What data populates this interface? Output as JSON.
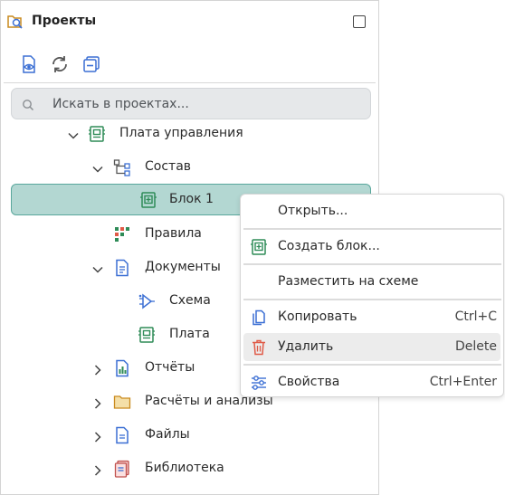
{
  "header": {
    "title": "Проекты",
    "icon": "project-search-icon"
  },
  "toolbar": {
    "buttons": [
      "document-view-icon",
      "refresh-icon",
      "collapse-all-icon"
    ]
  },
  "search": {
    "placeholder": "Искать в проектах..."
  },
  "tree": [
    {
      "label": "Плата управления",
      "icon": "pcb-board-icon",
      "expanded": true
    },
    {
      "label": "Состав",
      "icon": "hierarchy-icon",
      "expanded": true
    },
    {
      "label": "Блок 1",
      "icon": "block-icon",
      "selected": true
    },
    {
      "label": "Правила",
      "icon": "rules-grid-icon"
    },
    {
      "label": "Документы",
      "icon": "document-icon",
      "expanded": true
    },
    {
      "label": "Схема",
      "icon": "schematic-icon"
    },
    {
      "label": "Плата",
      "icon": "pcb-board-icon"
    },
    {
      "label": "Отчёты",
      "icon": "report-icon",
      "expanded": false
    },
    {
      "label": "Расчёты и анализы",
      "icon": "folder-icon",
      "expanded": false
    },
    {
      "label": "Файлы",
      "icon": "file-icon",
      "expanded": false
    },
    {
      "label": "Библиотека",
      "icon": "library-icon",
      "expanded": false
    }
  ],
  "context_menu": [
    {
      "label": "Открыть...",
      "shortcut": ""
    },
    {
      "label": "Создать блок...",
      "shortcut": "",
      "icon": "create-block-icon"
    },
    {
      "label": "Разместить на схеме",
      "shortcut": ""
    },
    {
      "label": "Копировать",
      "shortcut": "Ctrl+C",
      "icon": "copy-icon"
    },
    {
      "label": "Удалить",
      "shortcut": "Delete",
      "icon": "trash-icon",
      "hovered": true
    },
    {
      "label": "Свойства",
      "shortcut": "Ctrl+Enter",
      "icon": "properties-sliders-icon"
    }
  ],
  "colors": {
    "accent_green": "#2e8b57",
    "selection_bg": "#b3d7d2",
    "selection_border": "#59a79c",
    "icon_blue": "#3b6fd4",
    "delete_red": "#e05a47"
  }
}
